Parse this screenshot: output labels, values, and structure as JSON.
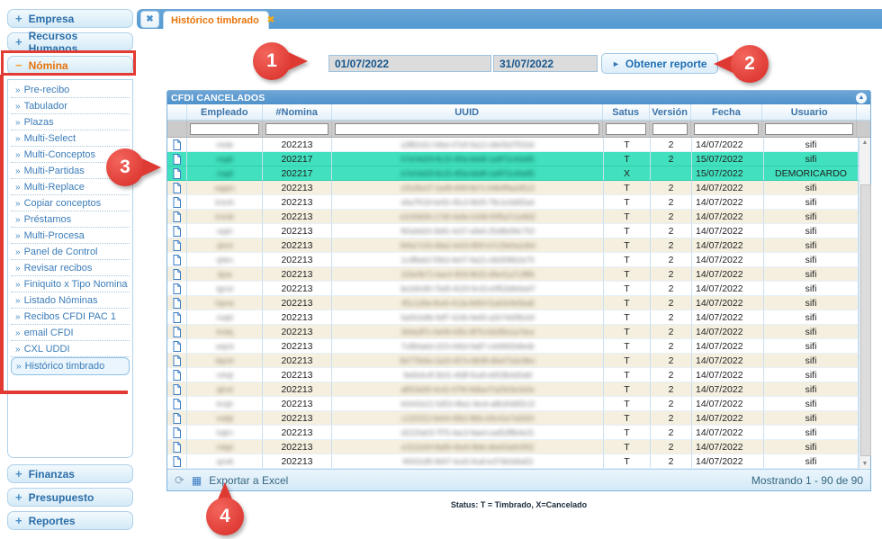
{
  "colors": {
    "tabbar_blue": "#539AD2",
    "panel_header_blue": "#5E9CD3",
    "highlight_green": "#41E0BE",
    "row_cream": "#F5EFDF",
    "callout_red": "#DE3A33",
    "active_tab_orange": "#E8730A",
    "link_blue": "#2A6DA8"
  },
  "tabbar": {
    "close_all_icon": "✖",
    "tab_label": "Histórico timbrado",
    "tab_close_icon": "✖"
  },
  "sidebar": {
    "sections_top": [
      {
        "icon": "+",
        "label": "Empresa"
      },
      {
        "icon": "+",
        "label": "Recursos Humanos"
      }
    ],
    "nomina_header": {
      "icon": "−",
      "label": "Nómina"
    },
    "nomina_items": [
      {
        "label": "Pre-recibo"
      },
      {
        "label": "Tabulador"
      },
      {
        "label": "Plazas"
      },
      {
        "label": "Multi-Select"
      },
      {
        "label": "Multi-Conceptos"
      },
      {
        "label": "Multi-Partidas"
      },
      {
        "label": "Multi-Replace"
      },
      {
        "label": "Copiar conceptos"
      },
      {
        "label": "Préstamos"
      },
      {
        "label": "Multi-Procesa"
      },
      {
        "label": "Panel de Control"
      },
      {
        "label": "Revisar recibos"
      },
      {
        "label": "Finiquito x Tipo Nomina"
      },
      {
        "label": "Listado Nóminas"
      },
      {
        "label": "Recibos CFDI PAC 1"
      },
      {
        "label": "email CFDI"
      },
      {
        "label": "CXL UDDI"
      },
      {
        "label": "Histórico timbrado",
        "selected": true
      }
    ],
    "sections_bottom": [
      {
        "icon": "+",
        "label": "Finanzas"
      },
      {
        "icon": "+",
        "label": "Presupuesto"
      },
      {
        "icon": "+",
        "label": "Reportes"
      }
    ]
  },
  "filters": {
    "date_from": "01/07/2022",
    "date_to": "31/07/2022",
    "report_button_icon": "►",
    "report_button_label": "Obtener reporte"
  },
  "panel": {
    "title": "CFDI CANCELADOS",
    "collapse_icon": "▲"
  },
  "table": {
    "columns": [
      "",
      "Empleado",
      "#Nomina",
      "UUID",
      "Satus",
      "Versión",
      "Fecha",
      "Usuario"
    ],
    "scroll_up_icon": "▲",
    "scroll_down_icon": "▼",
    "rows": [
      {
        "empleado": "mrde",
        "nomina": "202213",
        "uuid": "a3f82c61-04bd-47e9-9a12-c8e05d7f31b6",
        "satus": "T",
        "version": "2",
        "fecha": "14/07/2022",
        "usuario": "sifi",
        "hl": false
      },
      {
        "empleado": "mqdi",
        "nomina": "202217",
        "uuid": "b7e04d29-8c15-4f3a-b6d8-1a9f72c40e85",
        "satus": "T",
        "version": "2",
        "fecha": "15/07/2022",
        "usuario": "sifi",
        "hl": true
      },
      {
        "empleado": "mqdi",
        "nomina": "202217",
        "uuid": "b7e04d29-8c15-4f3a-b6d8-1a9f72c40e85",
        "satus": "X",
        "version": "",
        "fecha": "15/07/2022",
        "usuario": "DEMORICARDO",
        "hl": true
      },
      {
        "empleado": "wgqm",
        "nomina": "202213",
        "uuid": "c91d5e37-2a48-40bf-8e7c-64b0f9a2d513",
        "satus": "T",
        "version": "2",
        "fecha": "14/07/2022",
        "usuario": "sifi",
        "hl": false
      },
      {
        "empleado": "tmmh",
        "nomina": "202213",
        "uuid": "d4a7f018-6e92-45c3-9b05-78c1e3d6f2a4",
        "satus": "T",
        "version": "2",
        "fecha": "14/07/2022",
        "usuario": "sifi",
        "hl": false
      },
      {
        "empleado": "tmmk",
        "nomina": "202213",
        "uuid": "e2c83b56-17d0-4a9e-b348-90f5a7c1e8d2",
        "satus": "T",
        "version": "2",
        "fecha": "14/07/2022",
        "usuario": "sifi",
        "hl": false
      },
      {
        "empleado": "vqdn",
        "nomina": "202213",
        "uuid": "f60a9d24-3b81-4c57-a9e6-25d8b0f4c793",
        "satus": "T",
        "version": "2",
        "fecha": "14/07/2022",
        "usuario": "sifi",
        "hl": false
      },
      {
        "empleado": "qhmi",
        "nomina": "202213",
        "uuid": "0b5e7c93-48a2-4d16-8f30-b7c29e5a1d64",
        "satus": "T",
        "version": "2",
        "fecha": "14/07/2022",
        "usuario": "sifi",
        "hl": false
      },
      {
        "empleado": "qhtm",
        "nomina": "202213",
        "uuid": "1c4f8a62-59b3-4e07-9a21-c8d30f6b2e75",
        "satus": "T",
        "version": "2",
        "fecha": "14/07/2022",
        "usuario": "sifi",
        "hl": false
      },
      {
        "empleado": "tqna",
        "nomina": "202213",
        "uuid": "2d3e9b71-6ac4-4f18-8b32-d9e41a7c3f86",
        "satus": "T",
        "version": "2",
        "fecha": "14/07/2022",
        "usuario": "sifi",
        "hl": false
      },
      {
        "empleado": "tgmd",
        "nomina": "202213",
        "uuid": "3e2d0c80-7bd5-4029-9c43-e0f52b8d4a97",
        "satus": "T",
        "version": "2",
        "fecha": "14/07/2022",
        "usuario": "sifi",
        "hl": false
      },
      {
        "empleado": "hqme",
        "nomina": "202213",
        "uuid": "4f1c1d9a-8ce6-413a-8d54-f1a63c9e5ba8",
        "satus": "T",
        "version": "2",
        "fecha": "14/07/2022",
        "usuario": "sifi",
        "hl": false
      },
      {
        "empleado": "mqtd",
        "nomina": "202213",
        "uuid": "5a0b2e8b-9df7-424b-9e65-a2b74d0f6cb9",
        "satus": "T",
        "version": "2",
        "fecha": "14/07/2022",
        "usuario": "sifi",
        "hl": false
      },
      {
        "empleado": "tmdq",
        "nomina": "202213",
        "uuid": "6b9a3f7c-0e08-435c-8f76-b3c85e1a7dca",
        "satus": "T",
        "version": "2",
        "fecha": "14/07/2022",
        "usuario": "sifi",
        "hl": false
      },
      {
        "empleado": "wqmt",
        "nomina": "202213",
        "uuid": "7c884a6d-1f19-446d-9a87-c4d96f2b8edb",
        "satus": "T",
        "version": "2",
        "fecha": "14/07/2022",
        "usuario": "sifi",
        "hl": false
      },
      {
        "empleado": "dqmh",
        "nomina": "202213",
        "uuid": "8d775b5e-2a20-457e-8b98-d5e07a3c9fec",
        "satus": "T",
        "version": "2",
        "fecha": "14/07/2022",
        "usuario": "sifi",
        "hl": false
      },
      {
        "empleado": "mhqt",
        "nomina": "202213",
        "uuid": "9e664c4f-3b31-468f-9ca9-e6f18b4d0afd",
        "satus": "T",
        "version": "2",
        "fecha": "14/07/2022",
        "usuario": "sifi",
        "hl": false
      },
      {
        "empleado": "qtmd",
        "nomina": "202213",
        "uuid": "af553d30-4c42-4790-8dba-f7a29c5e1b0e",
        "satus": "T",
        "version": "2",
        "fecha": "14/07/2022",
        "usuario": "sifi",
        "hl": false
      },
      {
        "empleado": "tmqh",
        "nomina": "202213",
        "uuid": "b0442e21-5d53-48a1-9ecb-a8b30d6f2c1f",
        "satus": "T",
        "version": "2",
        "fecha": "14/07/2022",
        "usuario": "sifi",
        "hl": false
      },
      {
        "empleado": "mdqt",
        "nomina": "202213",
        "uuid": "c1331f12-6e64-49b2-8fdc-b9c41e7a3d20",
        "satus": "T",
        "version": "2",
        "fecha": "14/07/2022",
        "usuario": "sifi",
        "hl": false
      },
      {
        "empleado": "hqtm",
        "nomina": "202213",
        "uuid": "d2220a03-7f75-4ac3-9aed-cad52f8b4e31",
        "satus": "T",
        "version": "2",
        "fecha": "14/07/2022",
        "usuario": "sifi",
        "hl": false
      },
      {
        "empleado": "mtqd",
        "nomina": "202213",
        "uuid": "e3111b94-8a86-4bd4-8bfe-dbe63a9c5f42",
        "satus": "T",
        "version": "2",
        "fecha": "14/07/2022",
        "usuario": "sifi",
        "hl": false
      },
      {
        "empleado": "qmdt",
        "nomina": "202213",
        "uuid": "f4002c85-9b97-4ce5-9caf-ecf74b0d6a53",
        "satus": "T",
        "version": "2",
        "fecha": "14/07/2022",
        "usuario": "sifi",
        "hl": false
      }
    ]
  },
  "footer": {
    "refresh_icon": "⟳",
    "excel_icon": "▦",
    "export_label": "Exportar a Excel",
    "showing": "Mostrando 1 - 90 de 90"
  },
  "legend": "Status: T = Timbrado, X=Cancelado",
  "callouts": [
    {
      "number": "1"
    },
    {
      "number": "2"
    },
    {
      "number": "3"
    },
    {
      "number": "4"
    }
  ]
}
